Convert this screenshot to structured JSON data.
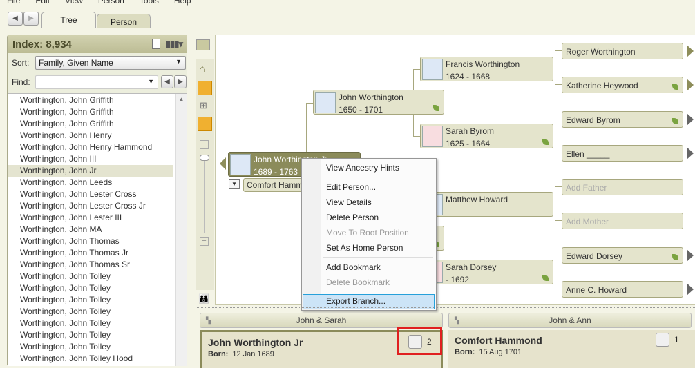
{
  "menu": [
    "File",
    "Edit",
    "View",
    "Person",
    "Tools",
    "Help"
  ],
  "tabs": [
    {
      "label": "Tree",
      "active": true
    },
    {
      "label": "Person",
      "active": false
    }
  ],
  "index": {
    "title": "Index: 8,934",
    "sort_label": "Sort:",
    "sort_value": "Family, Given Name",
    "find_label": "Find:",
    "find_value": "",
    "items": [
      "Worthington, John Griffith",
      "Worthington, John Griffith",
      "Worthington, John Griffith",
      "Worthington, John Henry",
      "Worthington, John Henry Hammond",
      "Worthington, John III",
      "Worthington, John Jr",
      "Worthington, John Leeds",
      "Worthington, John Lester Cross",
      "Worthington, John Lester Cross Jr",
      "Worthington, John Lester III",
      "Worthington, John MA",
      "Worthington, John Thomas",
      "Worthington, John Thomas Jr",
      "Worthington, John Thomas Sr",
      "Worthington, John Tolley",
      "Worthington, John Tolley",
      "Worthington, John Tolley",
      "Worthington, John Tolley",
      "Worthington, John Tolley",
      "Worthington, John Tolley",
      "Worthington, John Tolley",
      "Worthington, John Tolley Hood"
    ],
    "selected_index": 6
  },
  "tree": {
    "root": {
      "name": "John Worthington Jr",
      "years": "1689 - 1763"
    },
    "spouse": "Comfort Hammond",
    "father": {
      "name": "John Worthington",
      "years": "1650 - 1701"
    },
    "gen3": [
      {
        "name": "Francis Worthington",
        "years": "1624 - 1668"
      },
      {
        "name": "Sarah Byrom",
        "years": "1625 - 1664"
      },
      {
        "name": "Matthew Howard",
        "years": ""
      },
      {
        "name": "Sarah Dorsey",
        "years": "- 1692"
      }
    ],
    "gen4": [
      "Roger Worthington",
      "Katherine Heywood",
      "Edward Byrom",
      "Ellen _____",
      "Add Father",
      "Add Mother",
      "Edward Dorsey",
      "Anne C. Howard"
    ]
  },
  "context_menu": [
    {
      "label": "View Ancestry Hints",
      "enabled": true
    },
    {
      "label": "Edit Person...",
      "enabled": true
    },
    {
      "label": "View Details",
      "enabled": true
    },
    {
      "label": "Delete Person",
      "enabled": true
    },
    {
      "label": "Move To Root Position",
      "enabled": false
    },
    {
      "label": "Set As Home Person",
      "enabled": true
    },
    {
      "label": "Add Bookmark",
      "enabled": true
    },
    {
      "label": "Delete Bookmark",
      "enabled": false
    },
    {
      "label": "Export Branch...",
      "enabled": true,
      "highlighted": true
    }
  ],
  "families": [
    {
      "header": "John & Sarah",
      "name": "John Worthington Jr",
      "born_label": "Born:",
      "born": "12 Jan 1689",
      "count": "2"
    },
    {
      "header": "John & Ann",
      "name": "Comfort Hammond",
      "born_label": "Born:",
      "born": "15 Aug 1701",
      "count": "1"
    }
  ],
  "colors": {
    "accent": "#8b8b5a",
    "highlight": "#cce4f7",
    "annotation": "#e02020"
  }
}
